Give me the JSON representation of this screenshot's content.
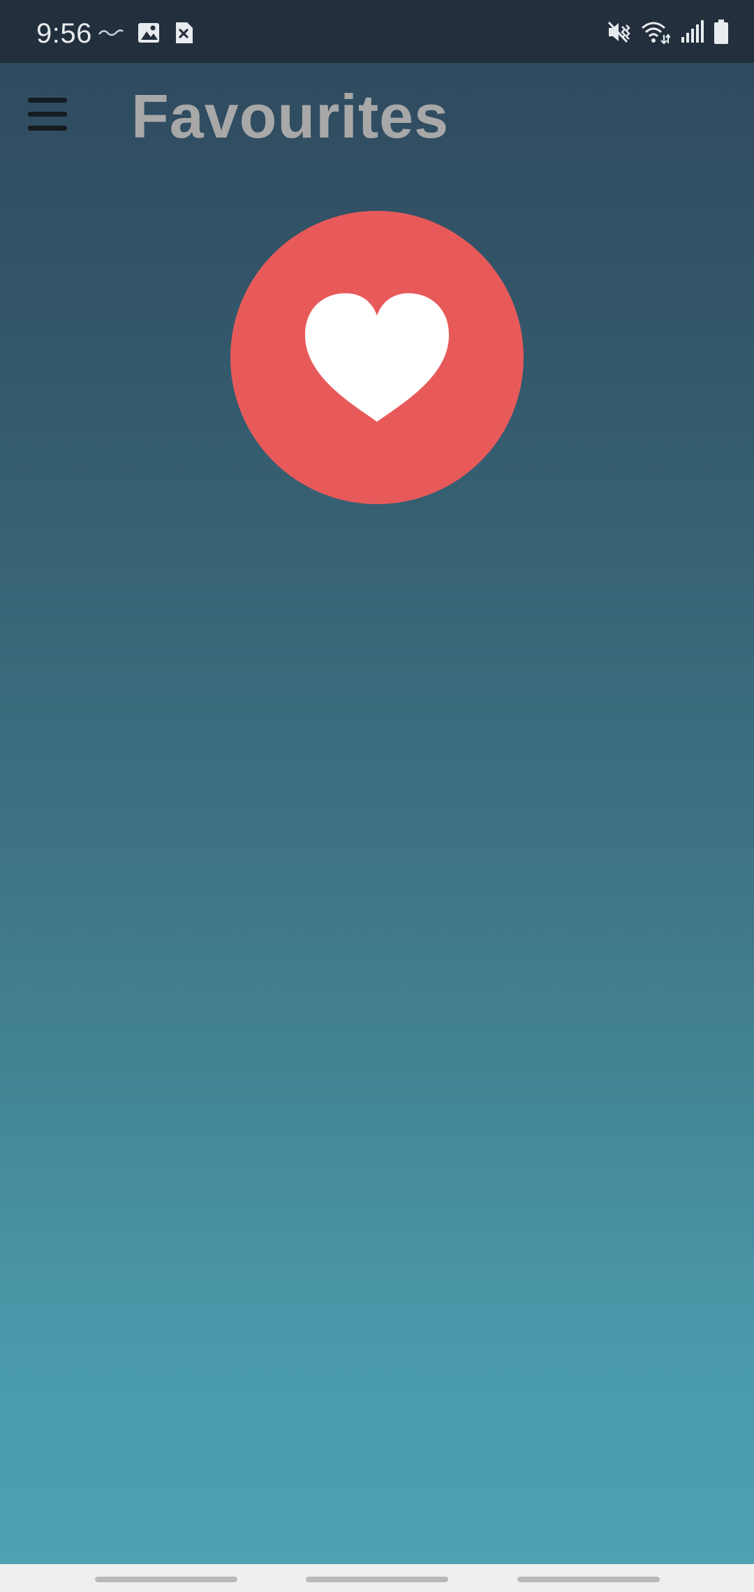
{
  "status_bar": {
    "time": "9:56",
    "left_icons": [
      "wave-icon",
      "image-icon",
      "close-box-icon"
    ],
    "right_icons": [
      "vibrate-mute-icon",
      "wifi-icon",
      "signal-icon",
      "battery-icon"
    ]
  },
  "app_bar": {
    "menu_icon": "hamburger-menu-icon",
    "title": "Favourites"
  },
  "content": {
    "badge_icon": "heart-icon",
    "badge_color": "#e85a5a",
    "heart_color": "#ffffff"
  },
  "theme": {
    "status_bar_bg": "#232f3c",
    "gradient_top": "#2f475c",
    "gradient_bottom": "#4ea2b2",
    "title_color": "#a8a8a8",
    "nav_bar_bg": "#efefef"
  }
}
